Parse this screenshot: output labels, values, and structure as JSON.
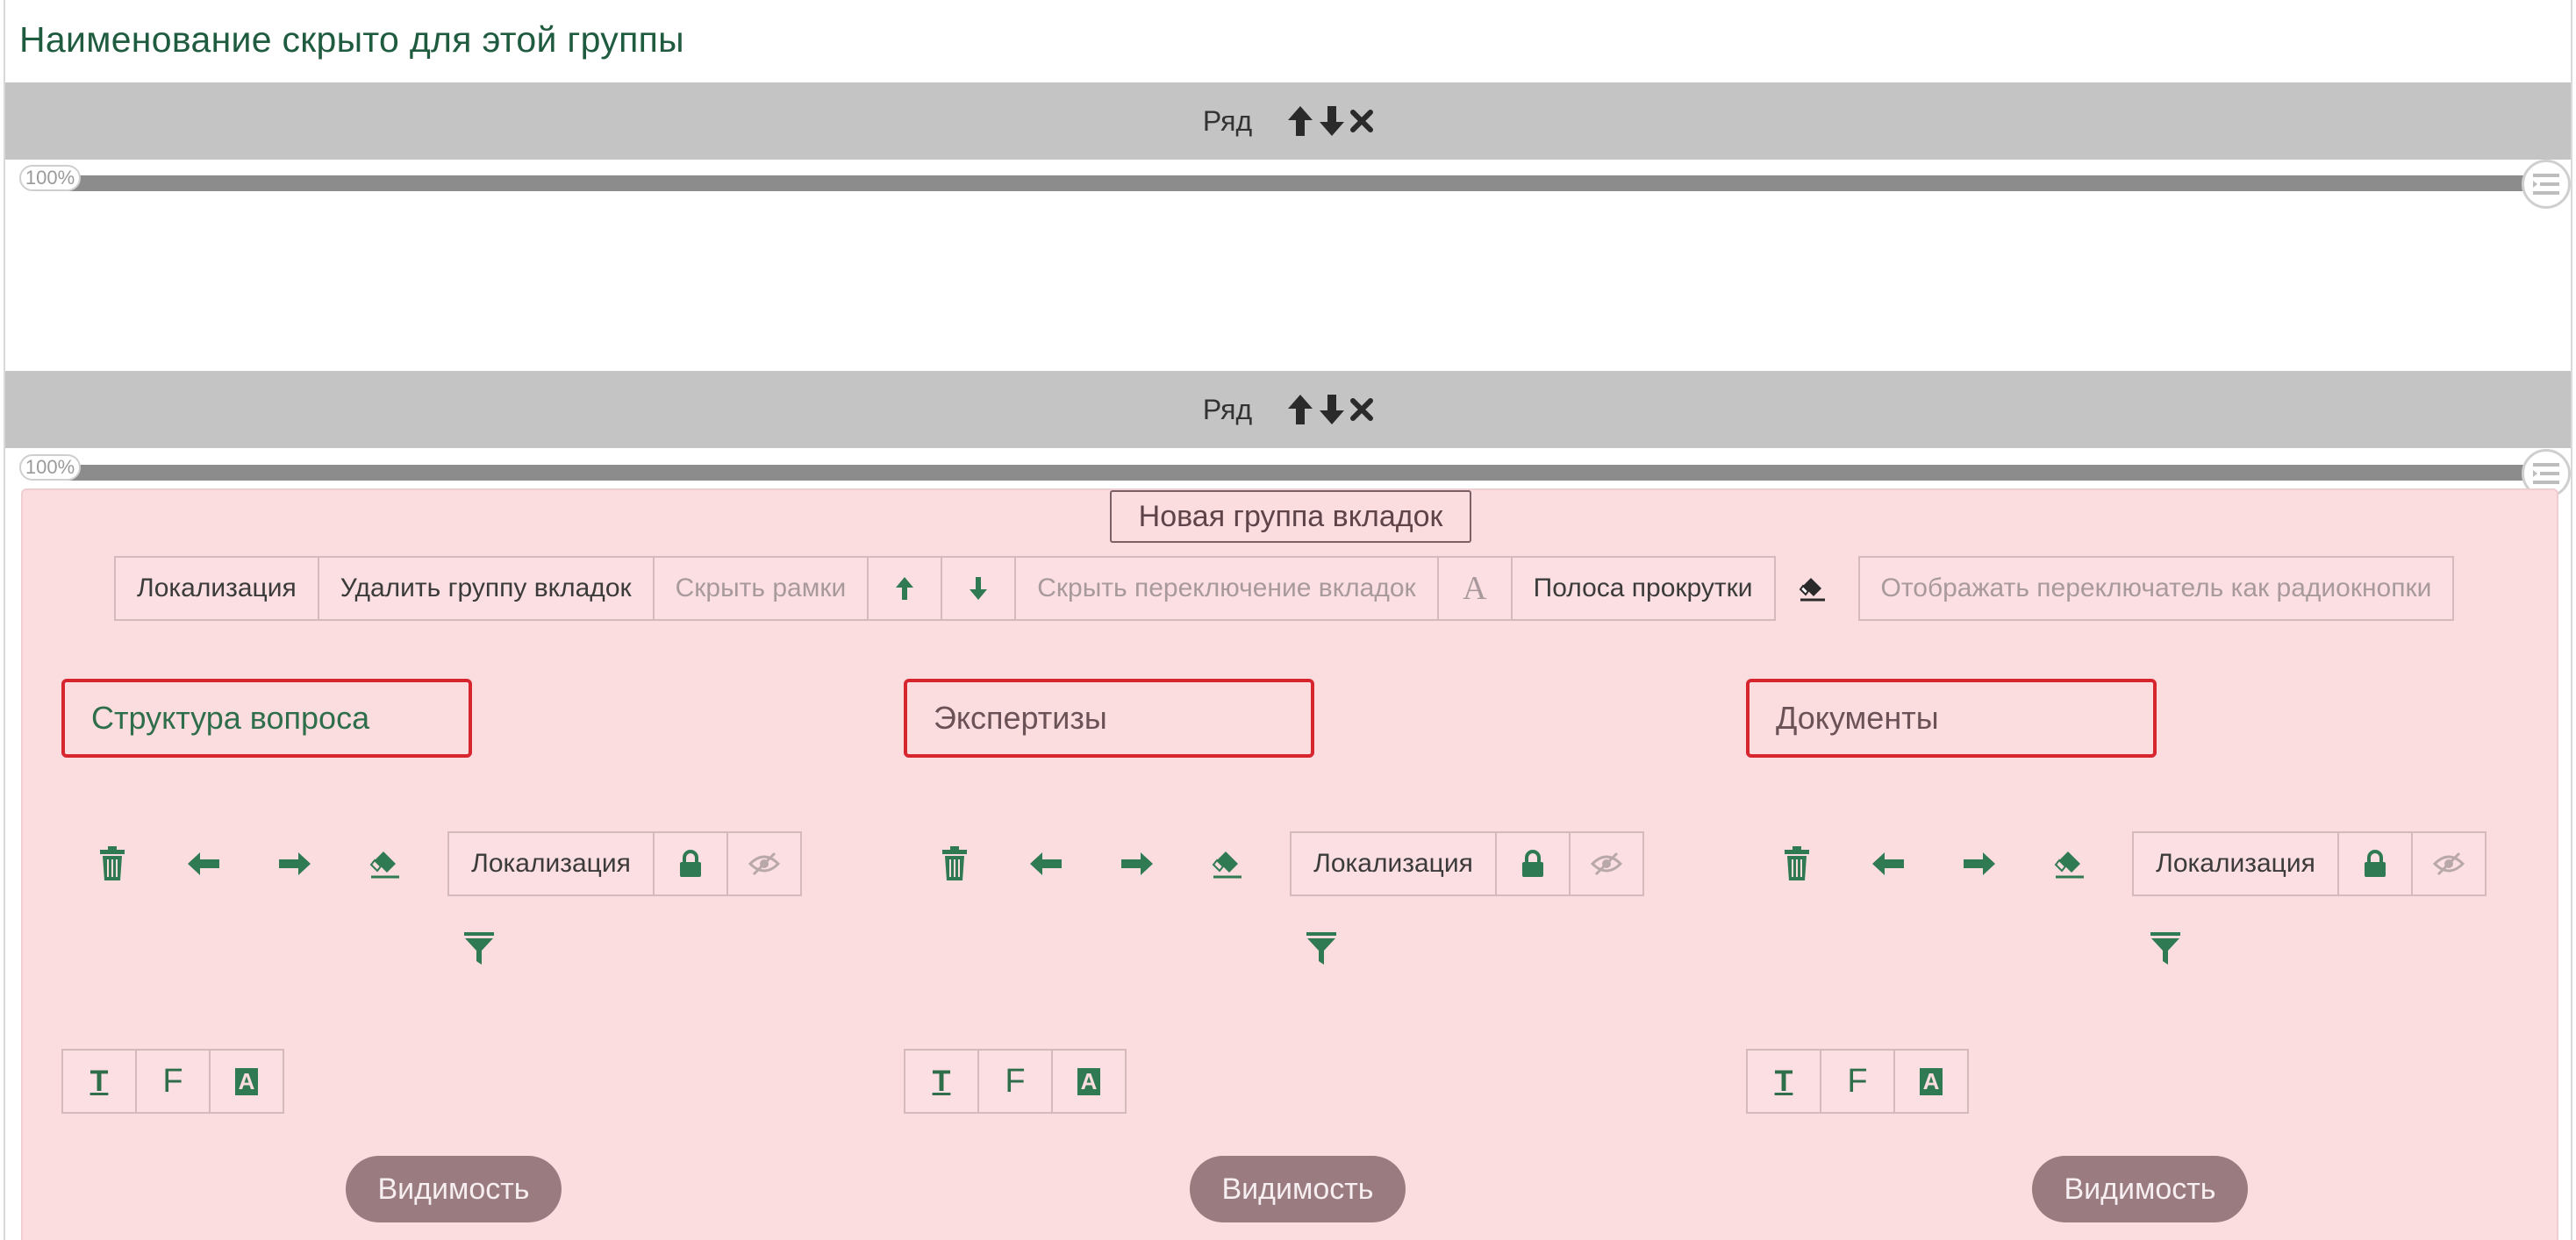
{
  "page": {
    "title": "Наименование скрыто для этой группы"
  },
  "rows": [
    {
      "label": "Ряд",
      "width_label": "100%"
    },
    {
      "label": "Ряд",
      "width_label": "100%"
    }
  ],
  "tab_group": {
    "title": "Новая группа вкладок",
    "toolbar": {
      "localization": "Локализация",
      "delete_group": "Удалить группу вкладок",
      "hide_borders": "Скрыть рамки",
      "hide_switching": "Скрыть переключение вкладок",
      "font_glyph": "A",
      "scrollbar": "Полоса прокрутки",
      "radio_switch": "Отображать переключатель как радиокнопки"
    },
    "tabs": [
      {
        "name": "Структура вопроса",
        "localization": "Локализация",
        "visibility": "Видимость",
        "state": "active"
      },
      {
        "name": "Экспертизы",
        "localization": "Локализация",
        "visibility": "Видимость",
        "state": "inactive"
      },
      {
        "name": "Документы",
        "localization": "Локализация",
        "visibility": "Видимость",
        "state": "inactive"
      }
    ],
    "format_buttons": [
      "T",
      "F",
      "A"
    ]
  },
  "colors": {
    "accent_green": "#2f7a52",
    "panel_pink": "#fbdde0",
    "row_gray": "#c4c4c4",
    "highlight_red": "#d8262f",
    "visibility_button": "#9a7b80"
  }
}
